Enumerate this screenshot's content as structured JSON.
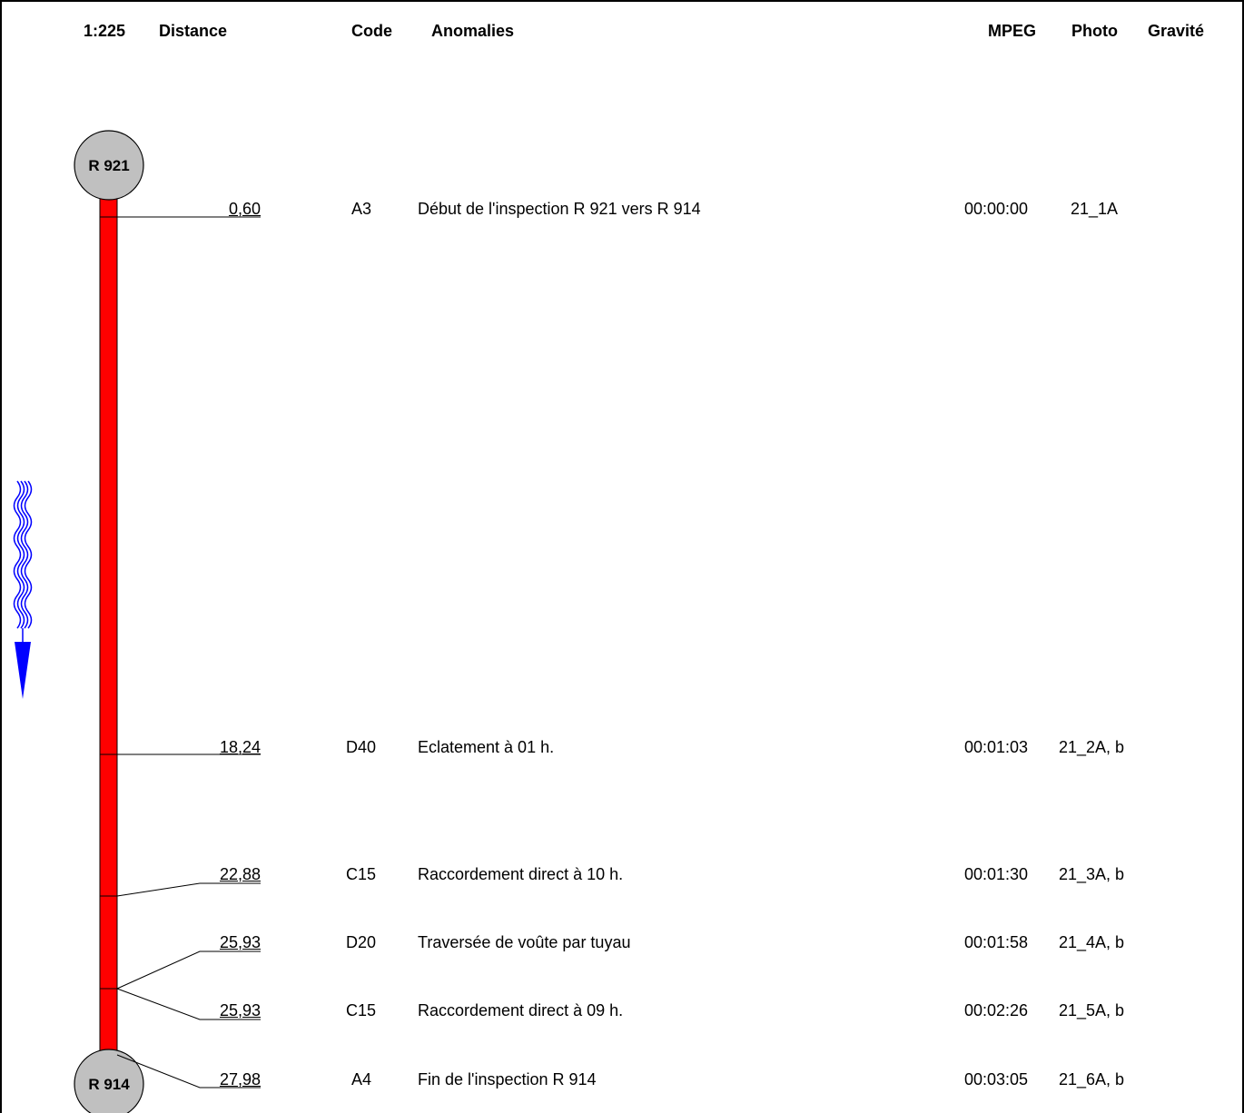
{
  "header": {
    "scale": "1:225",
    "distance": "Distance",
    "code": "Code",
    "anomalies": "Anomalies",
    "mpeg": "MPEG",
    "photo": "Photo",
    "gravite": "Gravité"
  },
  "nodes": {
    "start": "R 921",
    "end": "R 914"
  },
  "rows": [
    {
      "distance": "0,60",
      "code": "A3",
      "anomalie": "Début de l'inspection R 921 vers R 914",
      "mpeg": "00:00:00",
      "photo": "21_1A",
      "gravite": ""
    },
    {
      "distance": "18,24",
      "code": "D40",
      "anomalie": "Eclatement à 01 h.",
      "mpeg": "00:01:03",
      "photo": "21_2A, b",
      "gravite": ""
    },
    {
      "distance": "22,88",
      "code": "C15",
      "anomalie": "Raccordement direct à 10 h.",
      "mpeg": "00:01:30",
      "photo": "21_3A, b",
      "gravite": ""
    },
    {
      "distance": "25,93",
      "code": "D20",
      "anomalie": "Traversée de voûte par tuyau",
      "mpeg": "00:01:58",
      "photo": "21_4A, b",
      "gravite": ""
    },
    {
      "distance": "25,93",
      "code": "C15",
      "anomalie": "Raccordement direct à 09 h.",
      "mpeg": "00:02:26",
      "photo": "21_5A, b",
      "gravite": ""
    },
    {
      "distance": "27,98",
      "code": "A4",
      "anomalie": "Fin de l'inspection R 914",
      "mpeg": "00:03:05",
      "photo": "21_6A, b",
      "gravite": ""
    }
  ],
  "colors": {
    "pipe": "#ff0000",
    "node": "#c0c0c0",
    "flow": "#0000ff"
  },
  "icons": {
    "flow": "flow-direction-arrow-icon"
  }
}
